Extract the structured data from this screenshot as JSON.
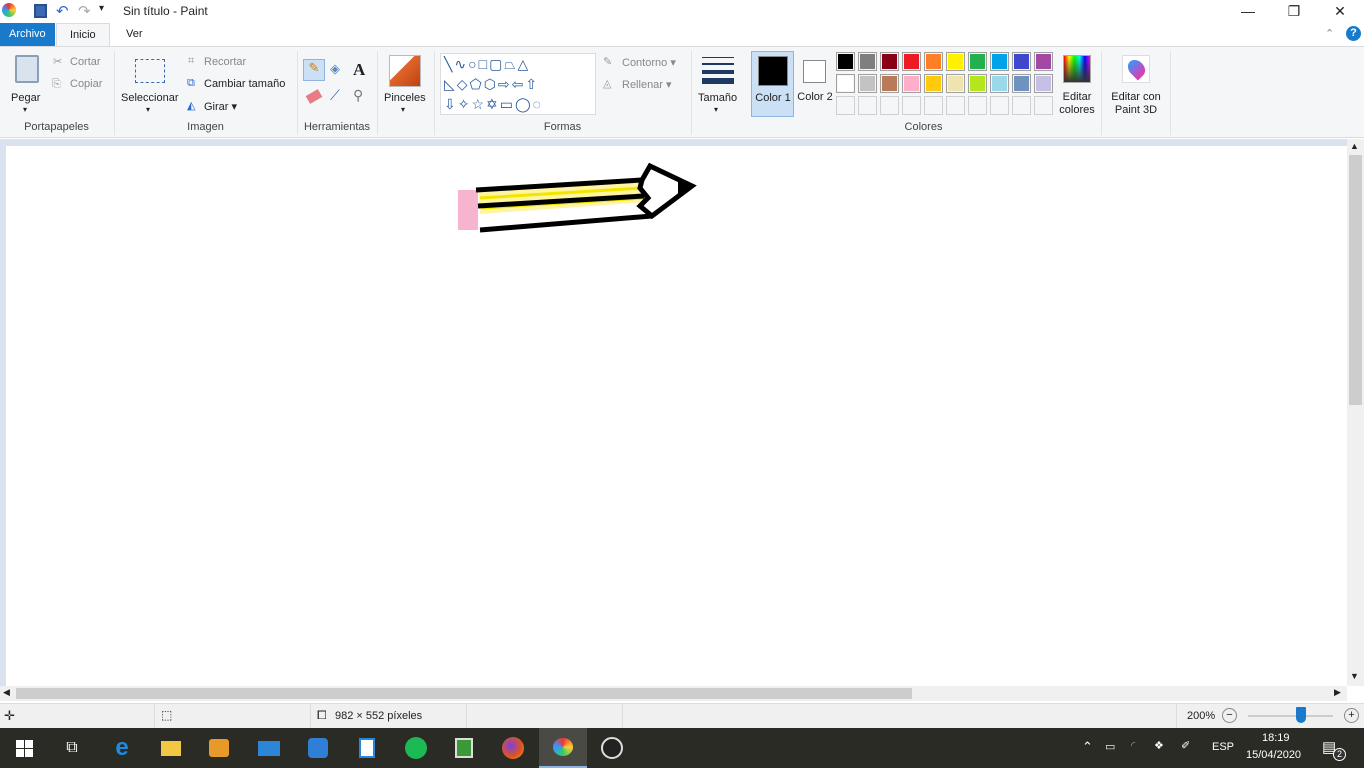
{
  "window": {
    "title": "Sin título - Paint",
    "minimize": "—",
    "maximize": "❐",
    "close": "✕"
  },
  "tabs": [
    {
      "label": "Archivo"
    },
    {
      "label": "Inicio"
    },
    {
      "label": "Ver"
    }
  ],
  "ribbon": {
    "clipboard": {
      "paste": "Pegar",
      "cut": "Cortar",
      "copy": "Copiar",
      "group": "Portapapeles"
    },
    "image": {
      "select": "Seleccionar",
      "crop": "Recortar",
      "resize": "Cambiar tamaño",
      "rotate": "Girar",
      "group": "Imagen"
    },
    "tools": {
      "group": "Herramientas",
      "text_tool": "A"
    },
    "brushes": {
      "label": "Pinceles"
    },
    "shapes": {
      "outline": "Contorno",
      "fill": "Rellenar",
      "group": "Formas"
    },
    "size": {
      "label": "Tamaño"
    },
    "colors": {
      "color1": "Color 1",
      "color2": "Color 2",
      "edit": "Editar colores",
      "group": "Colores",
      "color1_value": "#000000",
      "color2_value": "#ffffff",
      "row1": [
        "#000000",
        "#7f7f7f",
        "#880015",
        "#ed1c24",
        "#ff7f27",
        "#fff200",
        "#22b14c",
        "#00a2e8",
        "#3f48cc",
        "#a349a4"
      ],
      "row2": [
        "#ffffff",
        "#c3c3c3",
        "#b97a57",
        "#ffaec9",
        "#ffc90e",
        "#efe4b0",
        "#b5e61d",
        "#99d9ea",
        "#7092be",
        "#c8bfe7"
      ]
    },
    "paint3d": {
      "label": "Editar con Paint 3D"
    }
  },
  "status": {
    "dimensions": "982 × 552 píxeles",
    "zoom": "200%",
    "zoom_fraction": 0.62
  },
  "tray": {
    "lang": "ESP",
    "time": "18:19",
    "date": "15/04/2020",
    "notifications": "2"
  }
}
